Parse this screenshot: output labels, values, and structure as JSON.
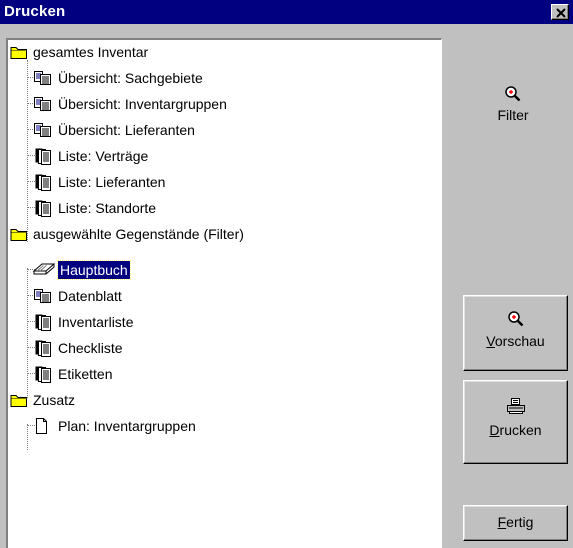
{
  "window": {
    "title": "Drucken"
  },
  "tree": {
    "items": [
      {
        "label": "gesamtes Inventar",
        "icon": "folder-icon"
      },
      {
        "label": "Übersicht: Sachgebiete",
        "icon": "report-icon"
      },
      {
        "label": "Übersicht: Inventargruppen",
        "icon": "report-icon"
      },
      {
        "label": "Übersicht: Lieferanten",
        "icon": "report-icon"
      },
      {
        "label": "Liste: Verträge",
        "icon": "list-icon"
      },
      {
        "label": "Liste: Lieferanten",
        "icon": "list-icon"
      },
      {
        "label": "Liste: Standorte",
        "icon": "list-icon"
      },
      {
        "label": "ausgewählte Gegenstände (Filter)",
        "icon": "folder-icon"
      },
      {
        "label": "Hauptbuch",
        "icon": "book-icon",
        "selected": true
      },
      {
        "label": "Datenblatt",
        "icon": "report-icon"
      },
      {
        "label": "Inventarliste",
        "icon": "list-icon"
      },
      {
        "label": "Checkliste",
        "icon": "list-icon"
      },
      {
        "label": "Etiketten",
        "icon": "list-icon"
      },
      {
        "label": "Zusatz",
        "icon": "folder-icon"
      },
      {
        "label": "Plan: Inventargruppen",
        "icon": "page-icon"
      }
    ]
  },
  "panel": {
    "filter_label": "Filter",
    "preview_mnemonic": "V",
    "preview_rest": "orschau",
    "print_mnemonic": "D",
    "print_rest": "rucken",
    "done_mnemonic": "F",
    "done_rest": "ertig"
  },
  "colors": {
    "titlebar": "#000080",
    "face": "#c0c0c0",
    "selection": "#000080",
    "folder": "#ffff00"
  }
}
